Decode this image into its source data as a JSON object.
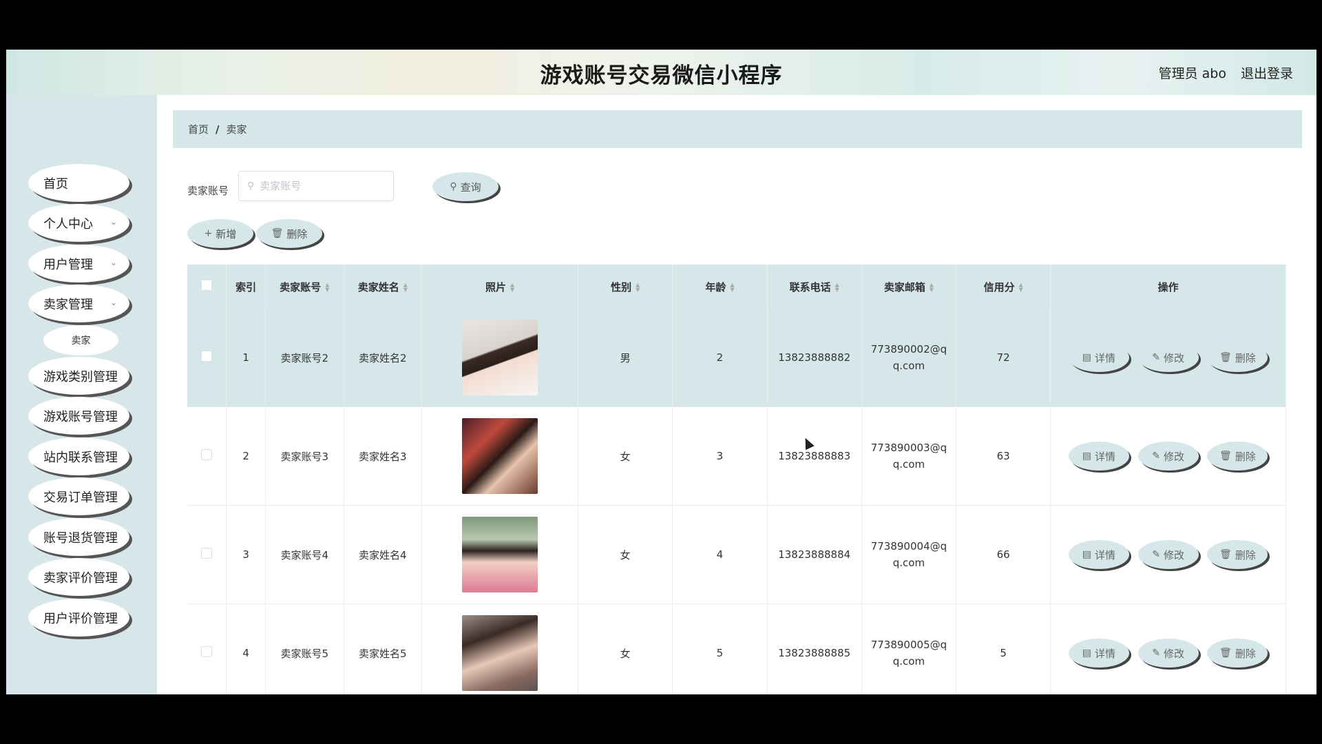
{
  "header": {
    "title": "游戏账号交易微信小程序",
    "admin": "管理员 abo",
    "logout": "退出登录"
  },
  "sidebar": {
    "items": [
      {
        "label": "首页"
      },
      {
        "label": "个人中心"
      },
      {
        "label": "用户管理"
      },
      {
        "label": "卖家管理"
      },
      {
        "label": "卖家"
      },
      {
        "label": "游戏类别管理"
      },
      {
        "label": "游戏账号管理"
      },
      {
        "label": "站内联系管理"
      },
      {
        "label": "交易订单管理"
      },
      {
        "label": "账号退货管理"
      },
      {
        "label": "卖家评价管理"
      },
      {
        "label": "用户评价管理"
      }
    ]
  },
  "breadcrumb": {
    "home": "首页",
    "sep": "/",
    "current": "卖家"
  },
  "search": {
    "label": "卖家账号",
    "placeholder": "卖家账号",
    "value": "",
    "query_btn": "查询"
  },
  "toolbar": {
    "add": "新增",
    "delete": "删除"
  },
  "table": {
    "headers": [
      "索引",
      "卖家账号",
      "卖家姓名",
      "照片",
      "性别",
      "年龄",
      "联系电话",
      "卖家邮箱",
      "信用分",
      "操作"
    ],
    "rows": [
      {
        "index": "1",
        "account": "卖家账号2",
        "name": "卖家姓名2",
        "gender": "男",
        "age": "2",
        "phone": "13823888882",
        "email1": "773890002@q",
        "email2": "q.com",
        "credit": "72"
      },
      {
        "index": "2",
        "account": "卖家账号3",
        "name": "卖家姓名3",
        "gender": "女",
        "age": "3",
        "phone": "13823888883",
        "email1": "773890003@q",
        "email2": "q.com",
        "credit": "63"
      },
      {
        "index": "3",
        "account": "卖家账号4",
        "name": "卖家姓名4",
        "gender": "女",
        "age": "4",
        "phone": "13823888884",
        "email1": "773890004@q",
        "email2": "q.com",
        "credit": "66"
      },
      {
        "index": "4",
        "account": "卖家账号5",
        "name": "卖家姓名5",
        "gender": "女",
        "age": "5",
        "phone": "13823888885",
        "email1": "773890005@q",
        "email2": "q.com",
        "credit": "5"
      }
    ],
    "actions": {
      "detail": "详情",
      "edit": "修改",
      "delete": "删除"
    }
  }
}
